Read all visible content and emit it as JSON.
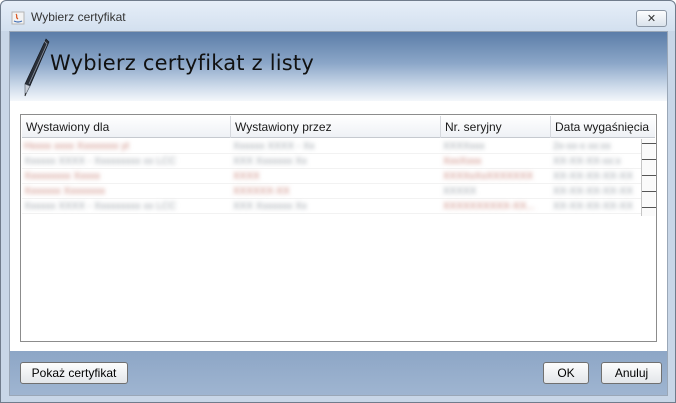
{
  "window": {
    "title": "Wybierz certyfikat",
    "close_label": "✕"
  },
  "header": {
    "title": "Wybierz certyfikat z listy"
  },
  "table": {
    "columns": [
      "Wystawiony dla",
      "Wystawiony przez",
      "Nr. seryjny",
      "Data wygaśnięcia"
    ],
    "rows": [
      [
        "Hxxxx xxxx Xxxxxxxx yt",
        "Xxxxxx XXXX - Xx",
        "XXXXxxx",
        "2x-xx-x xx:xx"
      ],
      [
        "Xxxxxx XXXX - Xxxxxxxxx xx LCC",
        "XXX Xxxxxxx Xx",
        "XxxXxxx",
        "XX-XX-XX-xx:x"
      ],
      [
        "Xxxxxxxxx Xxxxx",
        "XXXX",
        "XXXXxXxXXXXXXX",
        "XX-XX-XX-XX-XX"
      ],
      [
        "Xxxxxxx Xxxxxxxx",
        "XXXXXX-XX",
        "XXXXX",
        "XX-XX-XX-XX-XX"
      ],
      [
        "Xxxxxx XXXX - Xxxxxxxxx xx LCC",
        "XXX Xxxxxxx Xx",
        "XXXXXXXXXX-XX...",
        "XX-XX-XX-XX-XX"
      ]
    ]
  },
  "buttons": {
    "show_cert": "Pokaż certyfikat",
    "ok": "OK",
    "cancel": "Anuluj"
  }
}
